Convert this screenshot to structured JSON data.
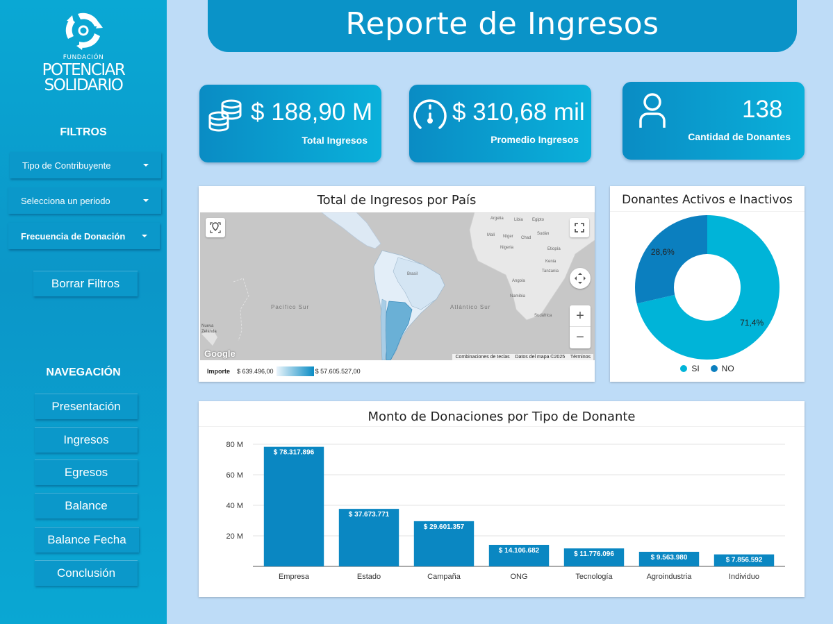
{
  "brand": {
    "org_small": "FUNDACIÓN",
    "org_line1": "POTENCIAR",
    "org_line2": "SOLIDARIO"
  },
  "sidebar": {
    "filters_heading": "FILTROS",
    "filters": [
      {
        "label": "Tipo de Contribuyente"
      },
      {
        "label": "Selecciona un periodo"
      },
      {
        "label": "Frecuencia de Donación"
      }
    ],
    "clear_label": "Borrar Filtros",
    "nav_heading": "NAVEGACIÓN",
    "nav": [
      {
        "label": "Presentación"
      },
      {
        "label": "Ingresos"
      },
      {
        "label": "Egresos"
      },
      {
        "label": "Balance"
      },
      {
        "label": "Balance Fecha"
      },
      {
        "label": "Conclusión"
      }
    ]
  },
  "header": {
    "title": "Reporte de Ingresos"
  },
  "kpis": [
    {
      "value": "$ 188,90 M",
      "label": "Total Ingresos",
      "icon": "coins-stack-icon"
    },
    {
      "value": "$ 310,68 mil",
      "label": "Promedio Ingresos",
      "icon": "speedometer-icon"
    },
    {
      "value": "138",
      "label": "Cantidad de Donantes",
      "icon": "user-icon"
    }
  ],
  "map_panel": {
    "title": "Total de Ingresos por País",
    "ocean_labels": [
      "Pacífico Sur",
      "Atlántico Sur"
    ],
    "place_labels": [
      "Argelia",
      "Libia",
      "Egipto",
      "Malí",
      "Níger",
      "Chad",
      "Sudán",
      "Nigeria",
      "Etiopía",
      "Kenia",
      "Tanzania",
      "Angola",
      "Namibia",
      "Sudáfrica",
      "Brasil",
      "Nueva Zelanda"
    ],
    "footer": [
      "Combinaciones de teclas",
      "Datos del mapa ©2025",
      "Términos"
    ],
    "google": "Google",
    "legend_title": "Importe",
    "legend_min": "$ 639.496,00",
    "legend_max": "$ 57.605.527,00",
    "zoom_in": "+",
    "zoom_out": "−"
  },
  "donut_panel": {
    "title": "Donantes Activos e Inactivos",
    "slices": [
      {
        "name": "SI",
        "value": 71.4,
        "label": "71,4%",
        "color": "#00b4d8"
      },
      {
        "name": "NO",
        "value": 28.6,
        "label": "28,6%",
        "color": "#0b7fbf"
      }
    ]
  },
  "bar_panel": {
    "title": "Monto de Donaciones por Tipo de Donante"
  },
  "chart_data": {
    "type": "bar",
    "title": "Monto de Donaciones por Tipo de Donante",
    "categories": [
      "Empresa",
      "Estado",
      "Campaña",
      "ONG",
      "Tecnología",
      "Agroindustria",
      "Individuo"
    ],
    "values": [
      78317896,
      37673771,
      29601357,
      14106682,
      11776096,
      9563980,
      7856592
    ],
    "value_labels": [
      "$ 78.317.896",
      "$ 37.673.771",
      "$ 29.601.357",
      "$ 14.106.682",
      "$ 11.776.096",
      "$ 9.563.980",
      "$ 7.856.592"
    ],
    "yticks": [
      20000000,
      40000000,
      60000000,
      80000000
    ],
    "ytick_labels": [
      "20 M",
      "40 M",
      "60 M",
      "80 M"
    ],
    "ylim": [
      0,
      80000000
    ],
    "grid": true,
    "bar_color": "#0a87c2"
  },
  "colors": {
    "sidebar": "#0b96c8",
    "header": "#0a93c8",
    "background": "#bedcf7",
    "bar": "#0a87c2"
  }
}
